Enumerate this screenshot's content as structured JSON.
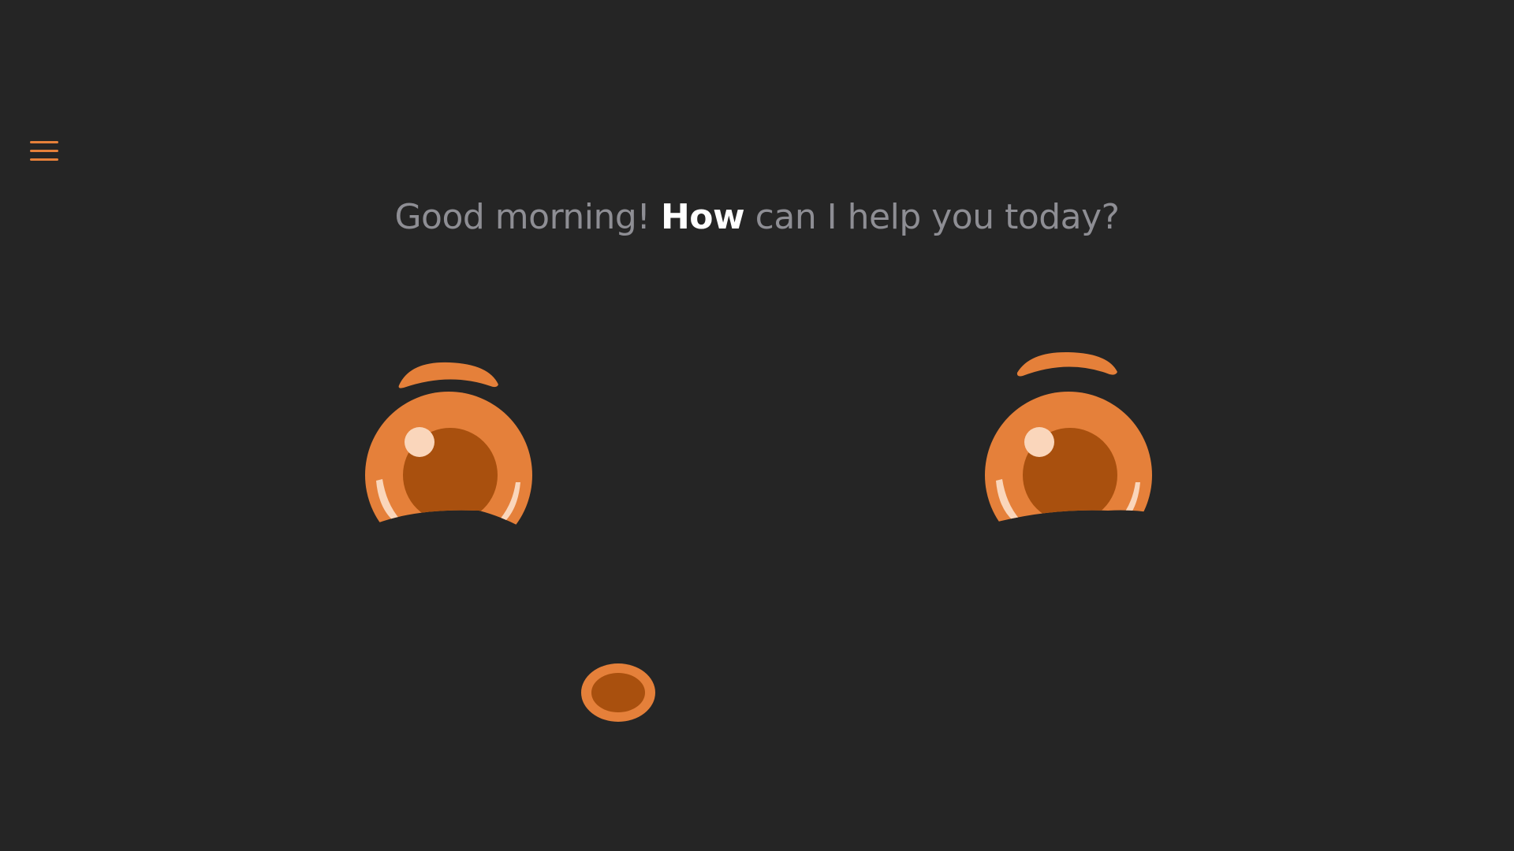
{
  "app": {
    "menu_icon": "hamburger-menu-icon"
  },
  "greeting": {
    "before": "Good morning! ",
    "highlight": "How",
    "after": " can I help you today?"
  },
  "colors": {
    "background": "#252525",
    "accent": "#e5803a",
    "accent_dark": "#a9500e",
    "highlight": "#fad6bb",
    "text_muted": "#8e8e94",
    "text_strong": "#ffffff"
  },
  "mascot": {
    "icons": [
      "left-eye-icon",
      "right-eye-icon",
      "left-eyebrow-icon",
      "right-eyebrow-icon",
      "mouth-icon"
    ]
  }
}
